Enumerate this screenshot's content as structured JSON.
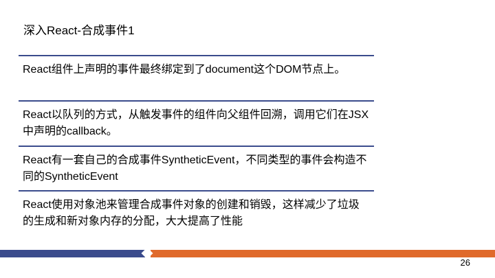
{
  "slide": {
    "title": "深入React-合成事件1",
    "items": [
      "React组件上声明的事件最终绑定到了document这个DOM节点上。",
      "React以队列的方式，从触发事件的组件向父组件回溯，调用它们在JSX中声明的callback。",
      "React有一套自己的合成事件SyntheticEvent，不同类型的事件会构造不同的SyntheticEvent",
      "React使用对象池来管理合成事件对象的创建和销毁，这样减少了垃圾的生成和新对象内存的分配，大大提高了性能"
    ],
    "page_number": "26"
  },
  "colors": {
    "accent_blue": "#3a4b8c",
    "accent_orange": "#e06a2b"
  }
}
